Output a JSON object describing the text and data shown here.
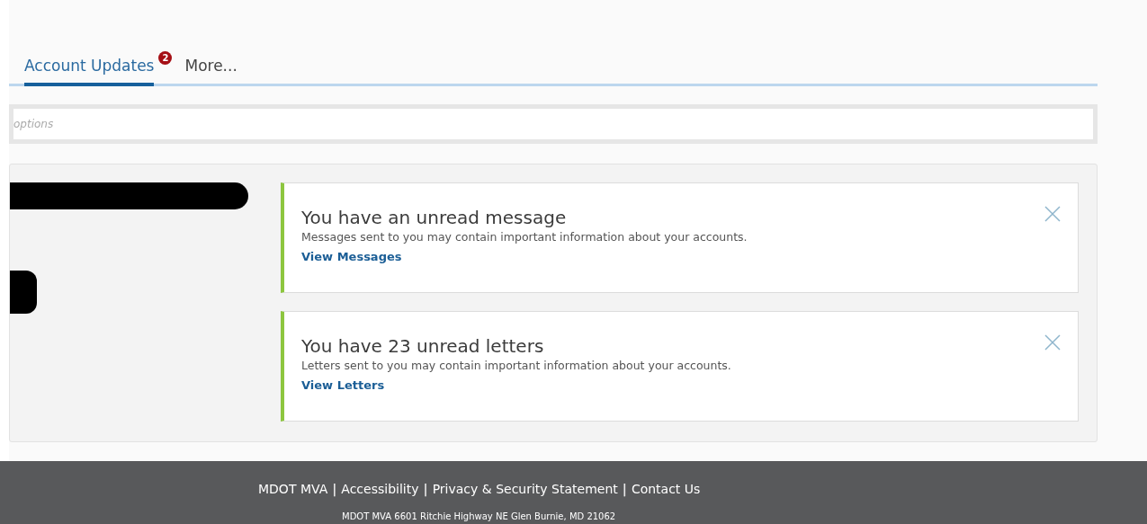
{
  "tabs": [
    {
      "label": "Account Updates",
      "selected": true,
      "badge": "2"
    },
    {
      "label": "More...",
      "selected": false
    }
  ],
  "search": {
    "placeholder": "options"
  },
  "notices": [
    {
      "title": "You have an unread message",
      "text": "Messages sent to you may contain important information about your accounts.",
      "link": "View Messages"
    },
    {
      "title": "You have 23 unread letters",
      "text": "Letters sent to you may contain important information about your accounts.",
      "link": "View Letters"
    }
  ],
  "footer": {
    "items": [
      {
        "kind": "link",
        "text": "MDOT MVA"
      },
      {
        "kind": "separator",
        "text": "|"
      },
      {
        "kind": "link",
        "text": "Accessibility"
      },
      {
        "kind": "separator",
        "text": "|"
      },
      {
        "kind": "link",
        "text": "Privacy & Security Statement"
      },
      {
        "kind": "separator",
        "text": "|"
      },
      {
        "kind": "link",
        "text": "Contact Us"
      }
    ],
    "address": "MDOT MVA 6601 Ritchie Highway NE Glen Burnie, MD 21062"
  }
}
